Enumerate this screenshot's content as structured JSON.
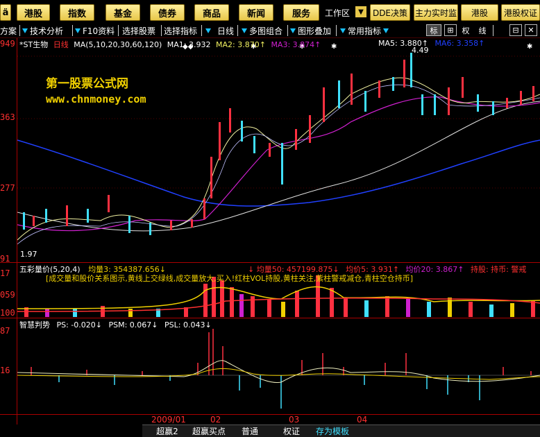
{
  "topbar": {
    "left_label": "ä",
    "buttons": [
      "港股",
      "指数",
      "基金",
      "债券",
      "商品",
      "新闻",
      "服务"
    ],
    "workzone": "工作区",
    "right_buttons": [
      "DDE决策",
      "主力实时监",
      "港股",
      "港股权证"
    ]
  },
  "toolbar": {
    "items": [
      "方案",
      "技术分析",
      "F10资料",
      "选择股票",
      "选择指标",
      "日线",
      "多图组合",
      "图形叠加",
      "常用指标"
    ],
    "icons": [
      {
        "label": "标",
        "name": "standard-icon"
      },
      {
        "label": "⊞",
        "name": "grid-icon"
      },
      {
        "label": "权",
        "name": "rights-icon"
      },
      {
        "label": "线",
        "name": "line-icon"
      },
      {
        "label": "⊟",
        "name": "window-icon"
      },
      {
        "label": "✕",
        "name": "close-icon"
      }
    ]
  },
  "main_chart": {
    "stock_name": "*ST生物",
    "period": "日线",
    "ma_spec": "MA(5,10,20,30,60,120)",
    "ma1": "MA1: 3.932",
    "ma2": "MA2: 3.870↑",
    "ma3": "MA3: 3.874↑",
    "ma5": "MA5: 3.880↑",
    "ma6": "MA6: 3.358↑",
    "high_label": "4.49",
    "low_label": "1.97",
    "watermark_title": "第一股票公式网",
    "watermark_url": "www.chnmoney.com",
    "y_labels": [
      "949",
      "363",
      "277",
      "91"
    ]
  },
  "volume_panel": {
    "title": "五彩量价(5,20,4)",
    "avg3": "均量3: 354387.656↓",
    "avg50": "↓ 均量50: 457199.875↓",
    "price5": "均价5: 3.931↑",
    "price20": "均价20: 3.867↑",
    "hold": "持股: 持币: 警戒",
    "desc": "[成交量和股价关系图示,黄线上交绿线,成交量放大,买入!红柱VOL持股,黄柱关注,紫柱警戒减仓,青柱空仓持币]",
    "y_labels": [
      "17",
      "059",
      "100"
    ]
  },
  "trend_panel": {
    "title": "智慧判势",
    "ps": "PS: -0.020↓",
    "psm": "PSM: 0.067↓",
    "psl": "PSL: 0.043↓",
    "y_labels": [
      "87",
      "16"
    ]
  },
  "time_axis": [
    "2009/01",
    "02",
    "03",
    "04"
  ],
  "bottom_tabs": [
    "超赢2",
    "超赢买点",
    "普通",
    "权证",
    "存为模板"
  ],
  "colors": {
    "button_gold": "#f0d060",
    "axis_red": "#ff3030",
    "ma_yellow": "#f0f0a0",
    "ma_purple": "#d020d0",
    "ma_blue": "#2040ff",
    "up_red": "#ff3040",
    "down_cyan": "#40e0ff"
  }
}
